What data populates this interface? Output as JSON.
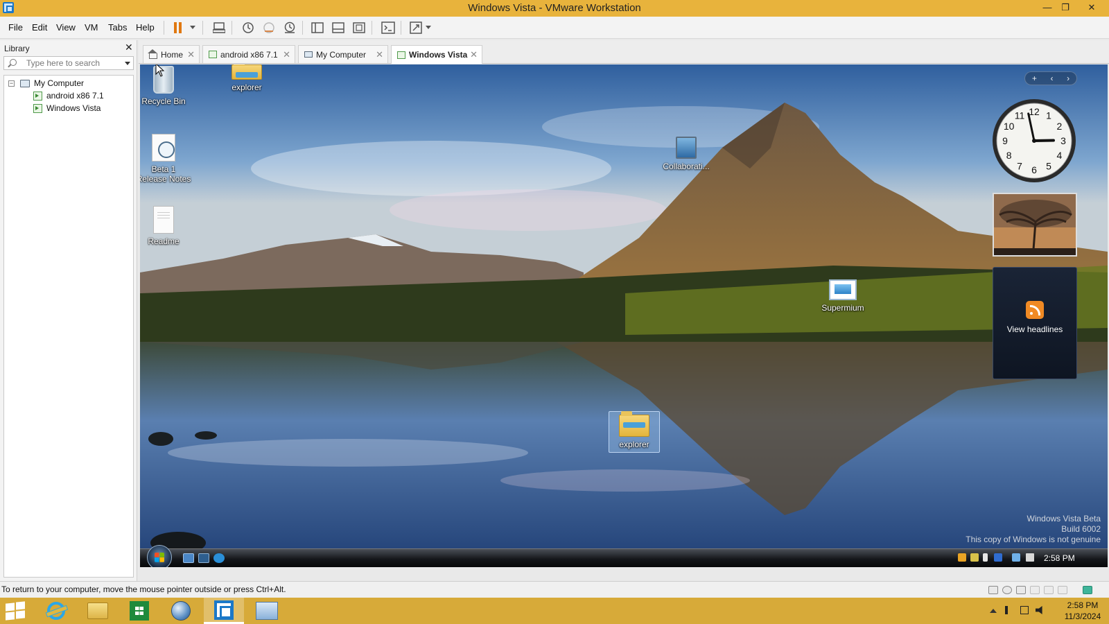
{
  "window": {
    "title": "Windows Vista - VMware Workstation",
    "minimize_glyph": "—",
    "maximize_glyph": "❐",
    "close_glyph": "✕"
  },
  "menu": {
    "file": "File",
    "edit": "Edit",
    "view": "View",
    "vm": "VM",
    "tabs": "Tabs",
    "help": "Help"
  },
  "toolbar": {
    "icons": [
      "pause-icon",
      "send-ctrl-alt-del-icon",
      "snapshot-icon",
      "revert-snapshot-icon",
      "snapshot-manager-icon",
      "library-view-icon",
      "thumbnail-bar-icon",
      "full-screen-icon",
      "console-view-icon",
      "stretch-guest-icon"
    ],
    "accent_color": "#e07810"
  },
  "library": {
    "title": "Library",
    "close_glyph": "✕",
    "search_placeholder": "Type here to search",
    "tree": {
      "root_label": "My Computer",
      "toggle_glyph": "−",
      "items": [
        {
          "label": "android x86 7.1"
        },
        {
          "label": "Windows Vista"
        }
      ]
    }
  },
  "tabs": [
    {
      "label": "Home",
      "icon": "home-icon",
      "close_glyph": "✕",
      "active": false
    },
    {
      "label": "android x86 7.1",
      "icon": "vm-icon",
      "close_glyph": "✕",
      "active": false
    },
    {
      "label": "My Computer",
      "icon": "computer-icon",
      "close_glyph": "✕",
      "active": false
    },
    {
      "label": "Windows Vista",
      "icon": "vm-icon",
      "close_glyph": "✕",
      "active": true
    }
  ],
  "desktop": {
    "icons": [
      {
        "label": "Recycle Bin",
        "icon": "recycle-bin-icon"
      },
      {
        "label": "explorer",
        "icon": "folder-icon"
      },
      {
        "label": "Beta 1\nRelease Notes",
        "icon": "release-notes-icon"
      },
      {
        "label": "Readme",
        "icon": "document-icon"
      },
      {
        "label": "Collaborati...",
        "icon": "network-computer-icon"
      },
      {
        "label": "Supermium",
        "icon": "supermium-icon"
      },
      {
        "label": "explorer",
        "icon": "folder-icon",
        "selected": true
      }
    ],
    "gadget_bar": {
      "add": "+",
      "prev": "‹",
      "next": "›"
    },
    "clock": {
      "numerals": [
        "12",
        "1",
        "2",
        "3",
        "4",
        "5",
        "6",
        "7",
        "8",
        "9",
        "10",
        "11"
      ],
      "time": "2:58"
    },
    "feed": {
      "label": "View headlines",
      "icon": "rss-icon"
    },
    "watermark": {
      "line1": "Windows Vista Beta",
      "line2": "Build 6002",
      "line3": "This copy of Windows is not genuine"
    }
  },
  "vista_taskbar": {
    "start": "start-orb-icon",
    "quick_launch": [
      "show-desktop-icon",
      "switch-windows-icon",
      "internet-explorer-icon"
    ],
    "tray_icons": [
      "security-shield-icon",
      "network-warning-icon",
      "battery-icon",
      "windows-sidebar-icon",
      "network-icon",
      "volume-icon"
    ],
    "time": "2:58 PM"
  },
  "statusbar": {
    "message": "To return to your computer, move the mouse pointer outside or press Ctrl+Alt.",
    "icons": [
      "hard-disk-icon",
      "cd-dvd-icon",
      "network-adapter-icon",
      "usb-icon",
      "printer-icon",
      "sound-icon",
      "message-icon"
    ]
  },
  "host_taskbar": {
    "start": "windows-start-icon",
    "apps": [
      {
        "name": "internet-explorer"
      },
      {
        "name": "file-explorer"
      },
      {
        "name": "windows-store"
      },
      {
        "name": "globe-browser"
      },
      {
        "name": "vmware-workstation",
        "active": true
      },
      {
        "name": "remote-desktop"
      }
    ],
    "tray": [
      "show-hidden-icons-icon",
      "action-center-flag-icon",
      "network-icon",
      "volume-muted-icon"
    ],
    "time": "2:58 PM",
    "date": "11/3/2024",
    "color": "#d7aa39"
  }
}
